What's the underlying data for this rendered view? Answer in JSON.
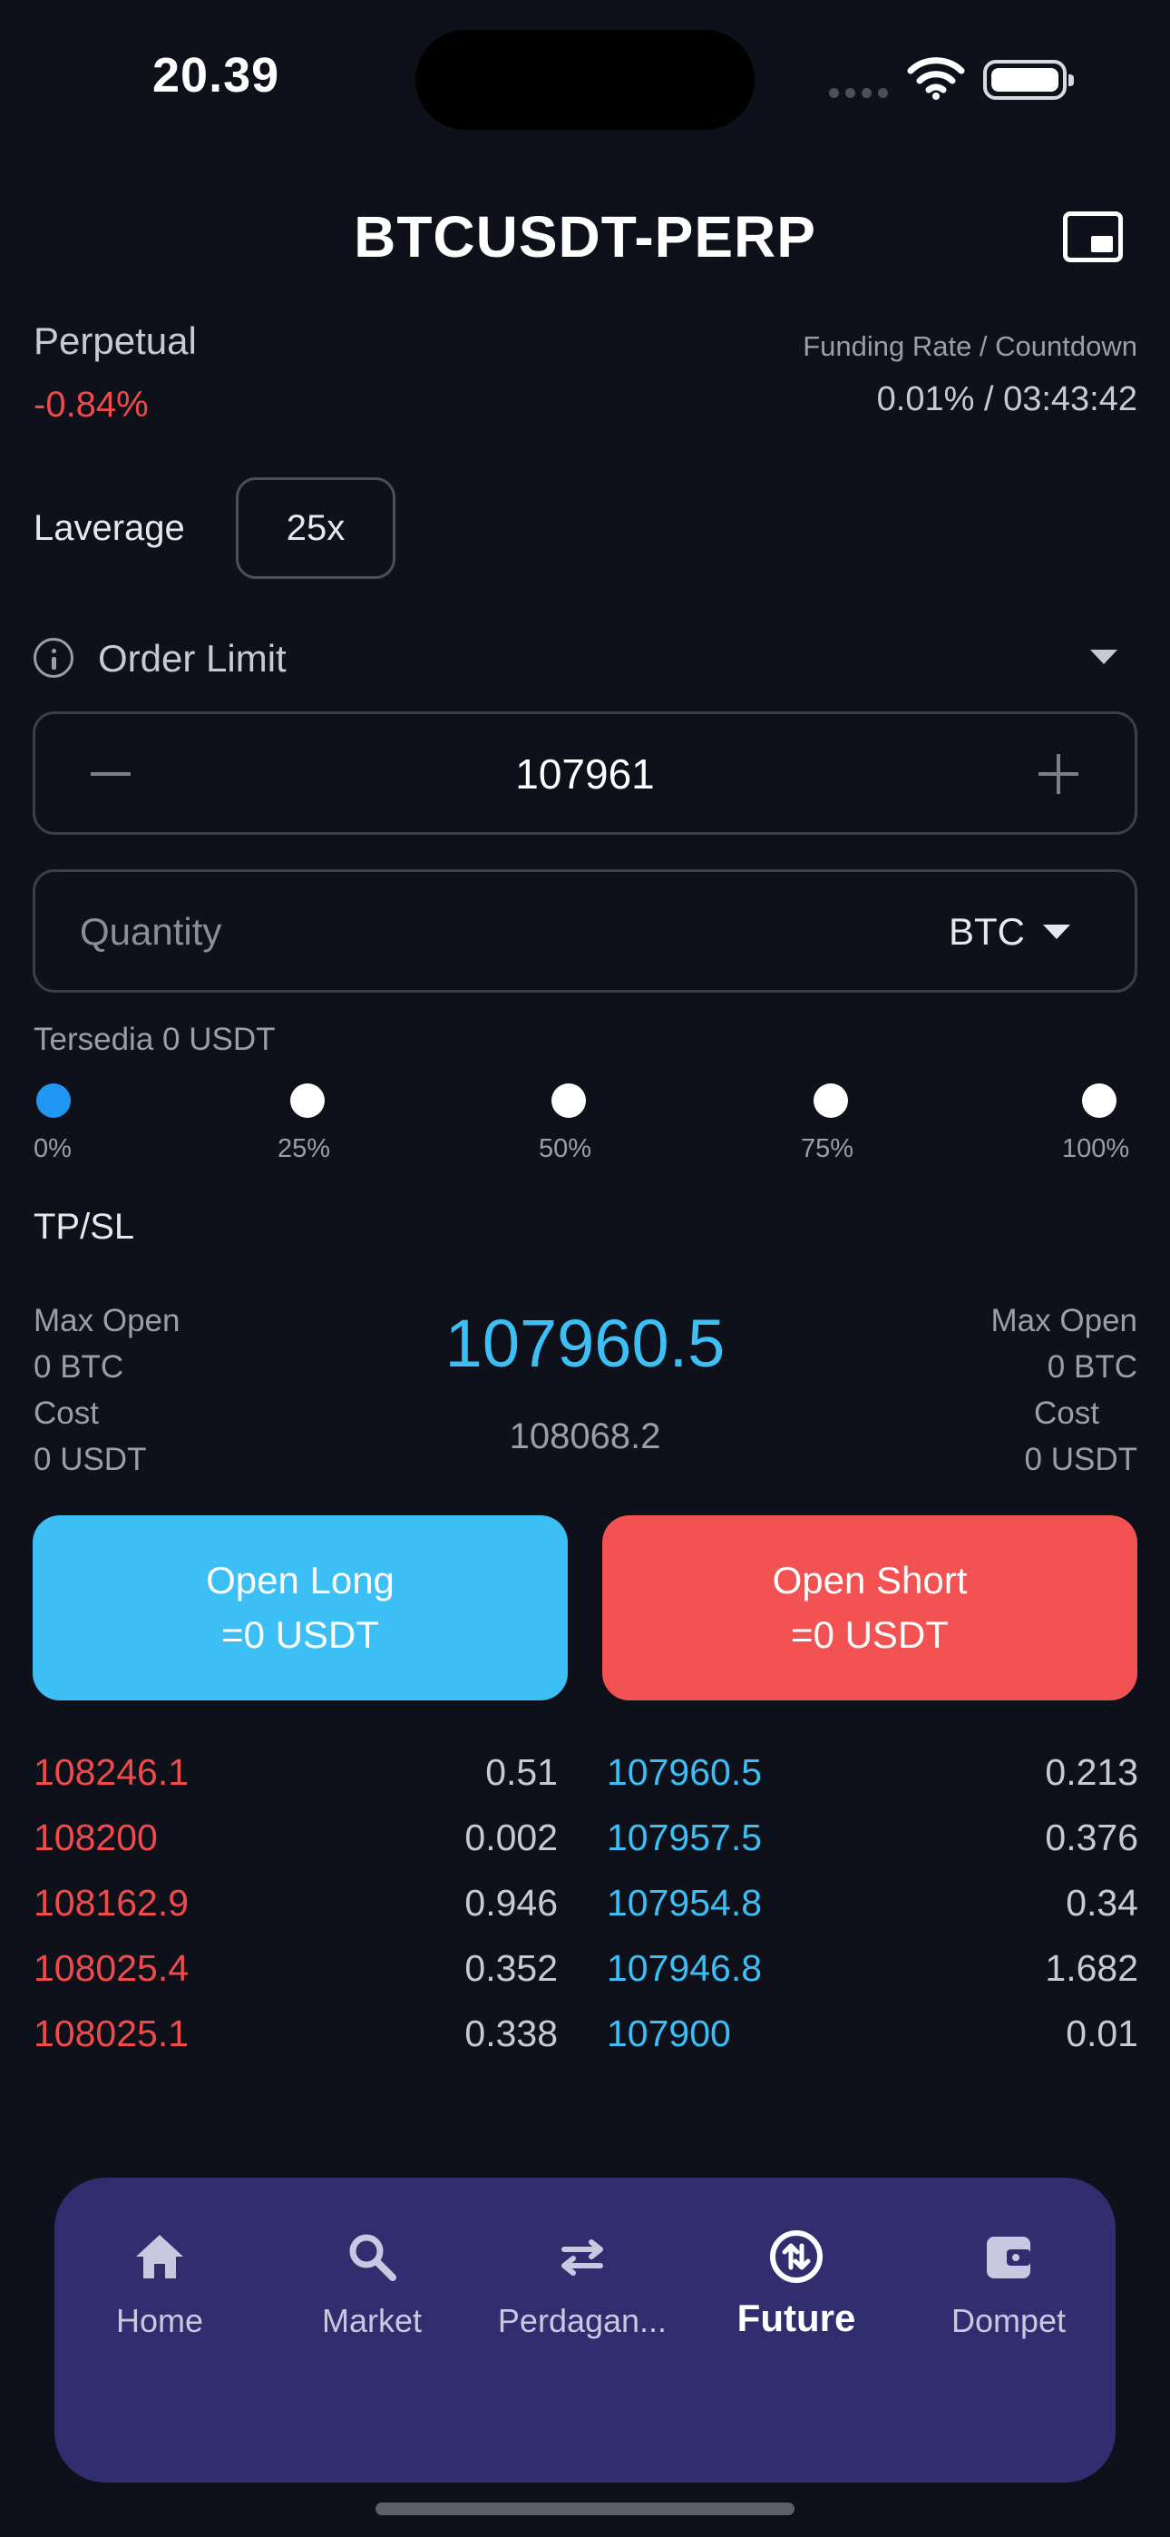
{
  "status_bar": {
    "time": "20.39"
  },
  "header": {
    "title": "BTCUSDT-PERP",
    "icon": "picture-in-picture-icon"
  },
  "market_info": {
    "type_label": "Perpetual",
    "change": "-0.84%",
    "funding_label": "Funding Rate / Countdown",
    "funding_value": "0.01% / 03:43:42"
  },
  "leverage": {
    "label": "Laverage",
    "value": "25x"
  },
  "order": {
    "type_label": "Order Limit",
    "price_value": "107961",
    "quantity_placeholder": "Quantity",
    "quantity_unit": "BTC",
    "available": "Tersedia 0 USDT"
  },
  "slider": {
    "labels": [
      "0%",
      "25%",
      "50%",
      "75%",
      "100%"
    ],
    "selected_percent": 0
  },
  "tpsl_label": "TP/SL",
  "summary": {
    "left": {
      "max_open_label": "Max Open",
      "max_open_value": "0 BTC",
      "cost_label": "Cost",
      "cost_value": "0 USDT"
    },
    "right": {
      "max_open_label": "Max Open",
      "max_open_value": "0 BTC",
      "cost_label": "Cost",
      "cost_value": "0 USDT"
    },
    "last_price": "107960.5",
    "mark_price": "108068.2"
  },
  "buttons": {
    "long_label": "Open Long",
    "long_value": "=0 USDT",
    "short_label": "Open Short",
    "short_value": "=0 USDT"
  },
  "order_book": {
    "rows": [
      {
        "ask_price": "108246.1",
        "ask_qty": "0.51",
        "bid_price": "107960.5",
        "bid_qty": "0.213"
      },
      {
        "ask_price": "108200",
        "ask_qty": "0.002",
        "bid_price": "107957.5",
        "bid_qty": "0.376"
      },
      {
        "ask_price": "108162.9",
        "ask_qty": "0.946",
        "bid_price": "107954.8",
        "bid_qty": "0.34"
      },
      {
        "ask_price": "108025.4",
        "ask_qty": "0.352",
        "bid_price": "107946.8",
        "bid_qty": "1.682"
      },
      {
        "ask_price": "108025.1",
        "ask_qty": "0.338",
        "bid_price": "107900",
        "bid_qty": "0.01"
      }
    ]
  },
  "tabbar": {
    "items": [
      {
        "label": "Home",
        "icon": "home-icon"
      },
      {
        "label": "Market",
        "icon": "search-icon"
      },
      {
        "label": "Perdagan...",
        "icon": "swap-icon"
      },
      {
        "label": "Future",
        "icon": "future-icon",
        "active": true
      },
      {
        "label": "Dompet",
        "icon": "wallet-icon"
      }
    ]
  },
  "colors": {
    "background": "#0e111a",
    "long": "#3bbff5",
    "short": "#f25252",
    "tabbar": "#312d6e",
    "slider_active": "#2196f3"
  }
}
